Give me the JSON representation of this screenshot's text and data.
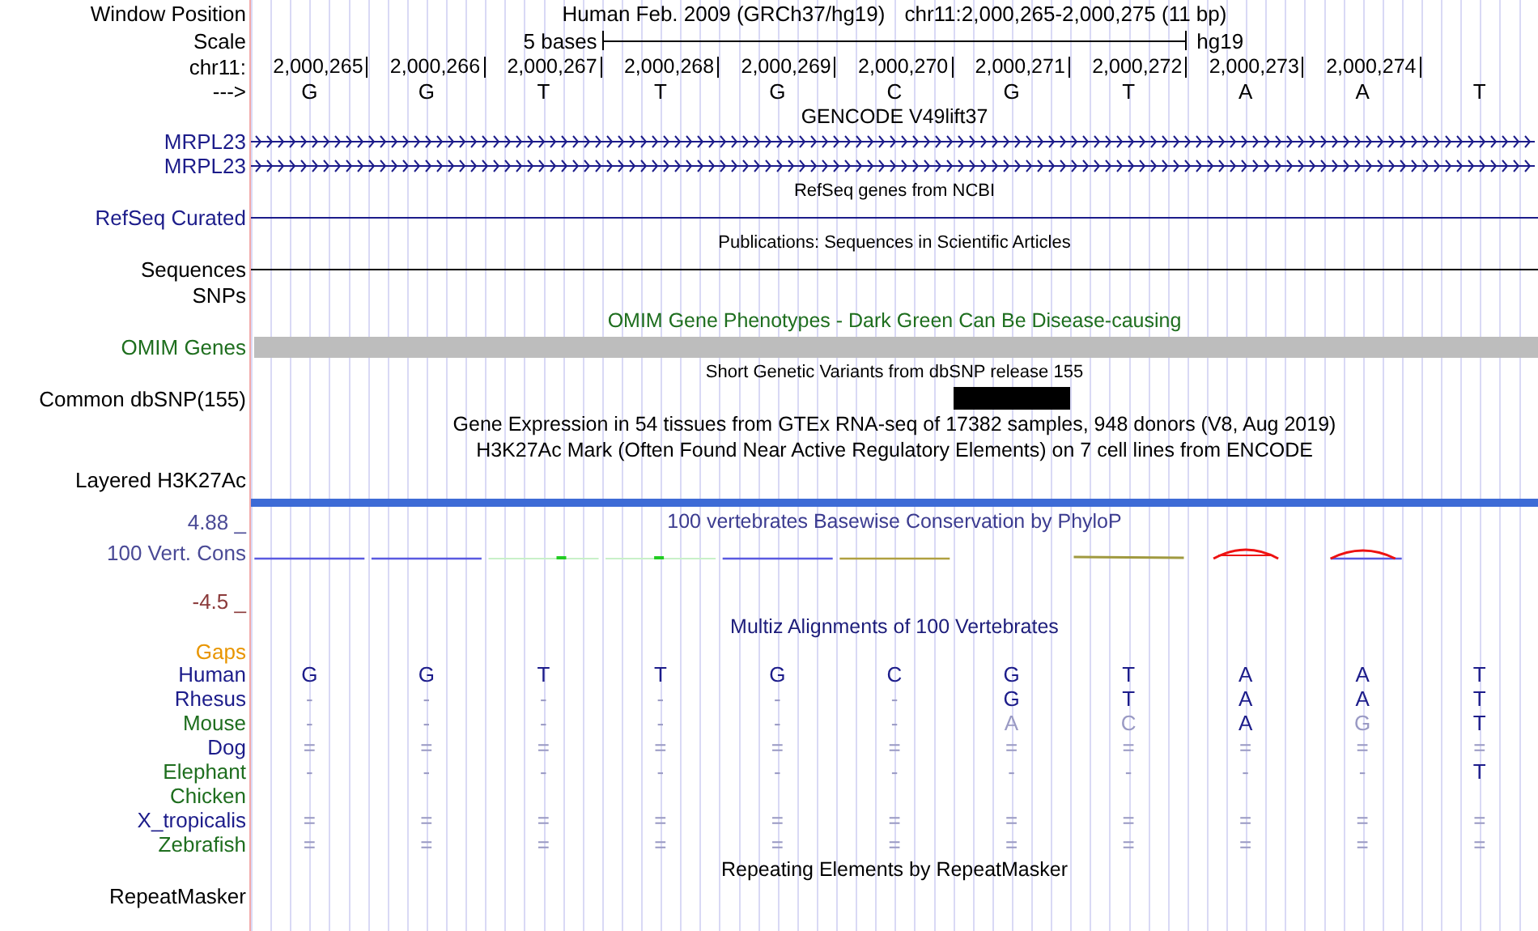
{
  "window_position": {
    "label": "Window Position",
    "assembly": "Human Feb. 2009 (GRCh37/hg19)",
    "position": "chr11:2,000,265-2,000,275 (11 bp)"
  },
  "scale": {
    "label": "Scale",
    "span": "5 bases",
    "assembly": "hg19"
  },
  "ruler": {
    "label": "chr11:",
    "ticks": [
      "2,000,265",
      "2,000,266",
      "2,000,267",
      "2,000,268",
      "2,000,269",
      "2,000,270",
      "2,000,271",
      "2,000,272",
      "2,000,273",
      "2,000,274"
    ]
  },
  "strand": {
    "label": "--->",
    "bases": [
      "G",
      "G",
      "T",
      "T",
      "G",
      "C",
      "G",
      "T",
      "A",
      "A",
      "T"
    ]
  },
  "tracks": [
    {
      "kind": "title",
      "text": "GENCODE V49lift37",
      "color": "#000000"
    },
    {
      "kind": "gene",
      "label": "MRPL23",
      "color": "#1c1c8a"
    },
    {
      "kind": "gene",
      "label": "MRPL23",
      "color": "#1c1c8a"
    },
    {
      "kind": "subtitle",
      "text": "RefSeq genes from NCBI",
      "color": "#000000"
    },
    {
      "kind": "line",
      "label": "RefSeq Curated",
      "color": "#1c1c8a"
    },
    {
      "kind": "subtitle",
      "text": "Publications: Sequences in Scientific Articles",
      "color": "#000000"
    },
    {
      "kind": "line",
      "label": "Sequences",
      "color": "#000000"
    },
    {
      "kind": "label",
      "label": "SNPs",
      "color": "#000000"
    },
    {
      "kind": "title",
      "text": "OMIM Gene Phenotypes - Dark Green Can Be Disease-causing",
      "color": "#1e6e1e"
    },
    {
      "kind": "bar",
      "label": "OMIM Genes",
      "color": "#1e6e1e"
    },
    {
      "kind": "subtitle",
      "text": "Short Genetic Variants from dbSNP release 155",
      "color": "#000000"
    },
    {
      "kind": "variant",
      "label": "Common dbSNP(155)",
      "color": "#000000"
    },
    {
      "kind": "title",
      "text": "Gene Expression in 54 tissues from GTEx RNA-seq of 17382 samples, 948 donors (V8, Aug 2019)",
      "color": "#000000"
    },
    {
      "kind": "title",
      "text": "H3K27Ac Mark (Often Found Near Active Regulatory Elements) on 7 cell lines from ENCODE",
      "color": "#000000"
    },
    {
      "kind": "layered",
      "label": "Layered H3K27Ac",
      "color": "#000000"
    }
  ],
  "conservation": {
    "title": "100 vertebrates Basewise Conservation by PhyloP",
    "label": "100 Vert. Cons",
    "max": "4.88 _",
    "min": "-4.5 _"
  },
  "alignment": {
    "title": "Multiz Alignments of 100 Vertebrates",
    "gaps_label": "Gaps",
    "species": [
      {
        "name": "Human",
        "color": "#1c1c8a",
        "bases": [
          "G",
          "G",
          "T",
          "T",
          "G",
          "C",
          "G",
          "T",
          "A",
          "A",
          "T"
        ],
        "faint": [
          false,
          false,
          false,
          false,
          false,
          false,
          false,
          false,
          false,
          false,
          false
        ]
      },
      {
        "name": "Rhesus",
        "color": "#1c1c8a",
        "bases": [
          "-",
          "-",
          "-",
          "-",
          "-",
          "-",
          "G",
          "T",
          "A",
          "A",
          "T"
        ],
        "faint": [
          true,
          true,
          true,
          true,
          true,
          true,
          false,
          false,
          false,
          false,
          false
        ]
      },
      {
        "name": "Mouse",
        "color": "#1e6e1e",
        "bases": [
          "-",
          "-",
          "-",
          "-",
          "-",
          "-",
          "A",
          "C",
          "A",
          "G",
          "T"
        ],
        "faint": [
          true,
          true,
          true,
          true,
          true,
          true,
          true,
          true,
          false,
          true,
          false
        ]
      },
      {
        "name": "Dog",
        "color": "#1c1c8a",
        "bases": [
          "=",
          "=",
          "=",
          "=",
          "=",
          "=",
          "=",
          "=",
          "=",
          "=",
          "="
        ],
        "faint": [
          true,
          true,
          true,
          true,
          true,
          true,
          true,
          true,
          true,
          true,
          true
        ]
      },
      {
        "name": "Elephant",
        "color": "#1e6e1e",
        "bases": [
          "-",
          "-",
          "-",
          "-",
          "-",
          "-",
          "-",
          "-",
          "-",
          "-",
          "T"
        ],
        "faint": [
          true,
          true,
          true,
          true,
          true,
          true,
          true,
          true,
          true,
          true,
          false
        ]
      },
      {
        "name": "Chicken",
        "color": "#1e6e1e"
      },
      {
        "name": "X_tropicalis",
        "color": "#1c1c8a",
        "bases": [
          "=",
          "=",
          "=",
          "=",
          "=",
          "=",
          "=",
          "=",
          "=",
          "=",
          "="
        ],
        "faint": [
          true,
          true,
          true,
          true,
          true,
          true,
          true,
          true,
          true,
          true,
          true
        ]
      },
      {
        "name": "Zebrafish",
        "color": "#1e6e1e",
        "bases": [
          "=",
          "=",
          "=",
          "=",
          "=",
          "=",
          "=",
          "=",
          "=",
          "=",
          "="
        ],
        "faint": [
          true,
          true,
          true,
          true,
          true,
          true,
          true,
          true,
          true,
          true,
          true
        ]
      }
    ]
  },
  "repeats": {
    "title": "Repeating Elements by RepeatMasker",
    "label": "RepeatMasker"
  }
}
